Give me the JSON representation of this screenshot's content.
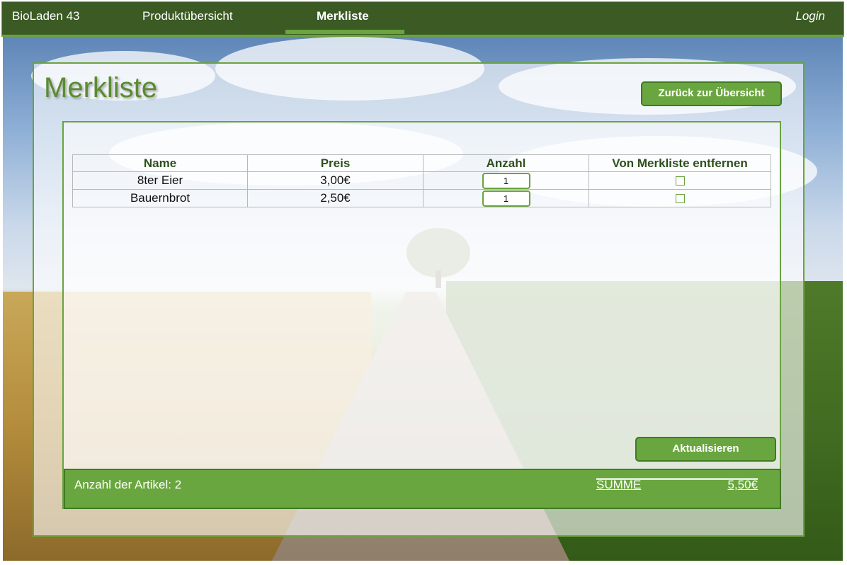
{
  "nav": {
    "brand": "BioLaden 43",
    "items": [
      {
        "label": "Produktübersicht",
        "active": false
      },
      {
        "label": "Merkliste",
        "active": true
      }
    ],
    "login": "Login"
  },
  "page": {
    "title": "Merkliste",
    "back_button": "Zurück zur Übersicht",
    "update_button": "Aktualisieren"
  },
  "table": {
    "headers": [
      "Name",
      "Preis",
      "Anzahl",
      "Von Merkliste entfernen"
    ],
    "rows": [
      {
        "name": "8ter Eier",
        "price": "3,00€",
        "quantity": "1",
        "remove": false
      },
      {
        "name": "Bauernbrot",
        "price": "2,50€",
        "quantity": "1",
        "remove": false
      }
    ]
  },
  "footer": {
    "count_label": "Anzahl der Artikel: 2",
    "sum_label": "SUMME",
    "sum_value": "5,50€"
  },
  "colors": {
    "nav_bg": "#3b5a24",
    "accent": "#6aa63f",
    "title": "#5a8c30"
  }
}
